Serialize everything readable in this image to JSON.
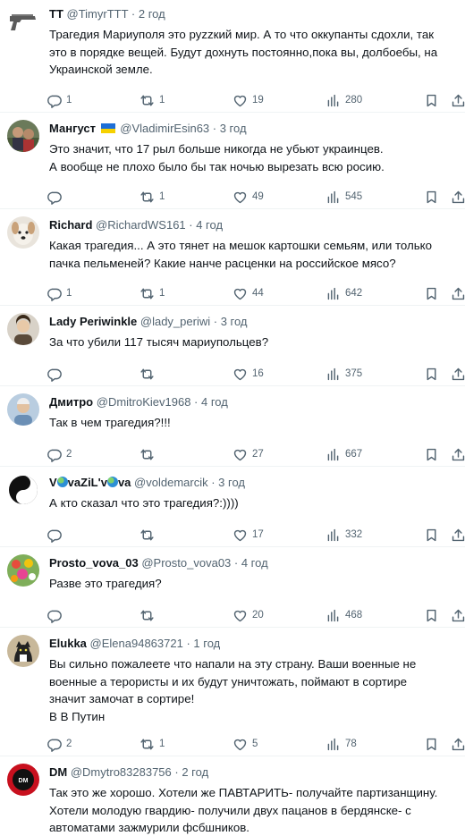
{
  "replies": [
    {
      "name": "TT",
      "handle": "@TimyrTTT",
      "time": "2 год",
      "avatar": "pistol-icon",
      "lines": [
        "Трагедия Мариуполя это руzzкий мир. А то что оккупанты сдохли, так",
        "это в порядке вещей. Будут дохнуть постоянно,пока вы, долбоебы, на",
        "Украинской земле."
      ],
      "replies": "1",
      "retweets": "1",
      "likes": "19",
      "views": "280"
    },
    {
      "name": "Мангуст",
      "handle": "@VladimirEsin63",
      "time": "3 год",
      "avatar": "photo-avatar",
      "flag": "ukraine-flag-icon",
      "lines": [
        "Это значит, что 17 рыл больше никогда не убьют украинцев.",
        "А вообще не плохо было бы так ночью вырезать всю росию."
      ],
      "replies": "",
      "retweets": "1",
      "likes": "49",
      "views": "545"
    },
    {
      "name": "Richard",
      "handle": "@RichardWS161",
      "time": "4 год",
      "avatar": "dog-avatar",
      "lines": [
        "Какая трагедия... А это тянет на мешок картошки семьям, или только",
        "пачка пельменей? Какие нанче расценки на российское мясо?"
      ],
      "replies": "1",
      "retweets": "1",
      "likes": "44",
      "views": "642"
    },
    {
      "name": "Lady Periwinkle",
      "handle": "@lady_periwi",
      "time": "3 год",
      "avatar": "woman-avatar",
      "lines": [
        "За что убили 117 тысяч мариупольцев?"
      ],
      "replies": "",
      "retweets": "",
      "likes": "16",
      "views": "375"
    },
    {
      "name": "Дмитро",
      "handle": "@DmitroKiev1968",
      "time": "4 год",
      "avatar": "man-avatar",
      "lines": [
        "Так в чем трагедия?!!!"
      ],
      "replies": "2",
      "retweets": "",
      "likes": "27",
      "views": "667"
    },
    {
      "name": "V",
      "name_mid": "vaZiL'v",
      "name_end": "va",
      "handle": "@voldemarcik",
      "time": "3 год",
      "avatar": "yin-yang-avatar",
      "lines": [
        "А кто сказал что это трагедия?:))))"
      ],
      "replies": "",
      "retweets": "",
      "likes": "17",
      "views": "332"
    },
    {
      "name": "Prosto_vova_03",
      "handle": "@Prosto_vova03",
      "time": "4 год",
      "avatar": "flowers-avatar",
      "lines": [
        "Разве это трагедия?"
      ],
      "replies": "",
      "retweets": "",
      "likes": "20",
      "views": "468"
    },
    {
      "name": "Elukka",
      "handle": "@Elena94863721",
      "time": "1 год",
      "avatar": "cat-avatar",
      "lines": [
        "Вы сильно пожалеете что напали на эту страну. Ваши военные не",
        "военные а терористы и их будут уничтожать, поймают в сортире",
        "значит замочат в сортире!",
        "В В Путин"
      ],
      "replies": "2",
      "retweets": "1",
      "likes": "5",
      "views": "78"
    },
    {
      "name": "DM",
      "handle": "@Dmytro83283756",
      "time": "2 год",
      "avatar": "dm-logo-avatar",
      "lines": [
        "Так это же хорошо. Хотели же ПАВТАРИТЬ- получайте партизанщину.",
        "Хотели молодую гвардию- получили двух пацанов в бердянске- с",
        "автоматами зажмурили фсбшников."
      ],
      "replies": "",
      "retweets": "",
      "likes": "",
      "views": ""
    }
  ],
  "colors": {
    "text": "#0f1419",
    "secondary": "#536471",
    "divider": "#eff3f4"
  }
}
